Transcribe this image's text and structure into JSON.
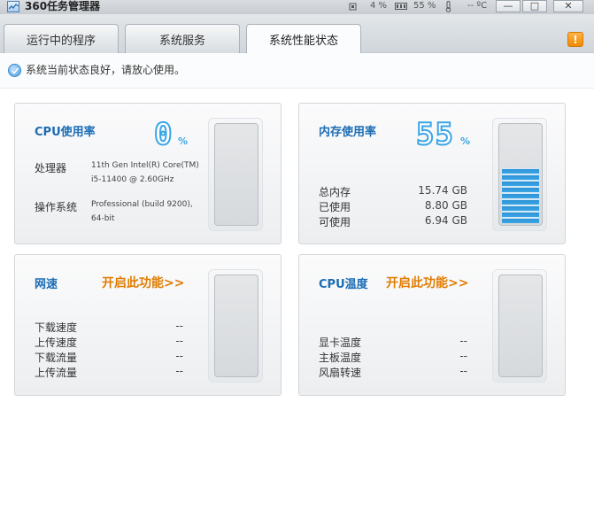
{
  "app": {
    "title": "360任务管理器"
  },
  "titlebar_stats": {
    "cpu": "4 %",
    "mem": "55 %",
    "temp": "-- ºC"
  },
  "window_controls": {
    "minimize": "—",
    "maximize": "□",
    "close": "✕"
  },
  "tabs": [
    {
      "label": "运行中的程序",
      "active": false
    },
    {
      "label": "系统服务",
      "active": false
    },
    {
      "label": "系统性能状态",
      "active": true
    }
  ],
  "warning_button": "!",
  "status": {
    "text": "系统当前状态良好，请放心使用。"
  },
  "cards": {
    "cpu": {
      "title": "CPU使用率",
      "value": "0",
      "unit": "%",
      "processor_label": "处理器",
      "processor_value": "11th Gen Intel(R) Core(TM) i5-11400 @ 2.60GHz",
      "os_label": "操作系统",
      "os_value": "Professional (build 9200), 64-bit",
      "level": 0
    },
    "memory": {
      "title": "内存使用率",
      "value": "55",
      "unit": "%",
      "rows": [
        {
          "label": "总内存",
          "value": "15.74 GB"
        },
        {
          "label": "已使用",
          "value": "8.80 GB"
        },
        {
          "label": "可使用",
          "value": "6.94 GB"
        }
      ],
      "level": 0.55
    },
    "network": {
      "title": "网速",
      "enable": "开启此功能>>",
      "rows": [
        {
          "label": "下载速度",
          "value": "--"
        },
        {
          "label": "上传速度",
          "value": "--"
        },
        {
          "label": "下载流量",
          "value": "--"
        },
        {
          "label": "上传流量",
          "value": "--"
        }
      ],
      "level": 0
    },
    "cpu_temp": {
      "title": "CPU温度",
      "enable": "开启此功能>>",
      "rows": [
        {
          "label": "显卡温度",
          "value": "--"
        },
        {
          "label": "主板温度",
          "value": "--"
        },
        {
          "label": "风扇转速",
          "value": "--"
        }
      ],
      "level": 0
    }
  },
  "colors": {
    "accent": "#3aa6e6",
    "title_blue": "#1b6cb4",
    "link_orange": "#e07c00"
  }
}
